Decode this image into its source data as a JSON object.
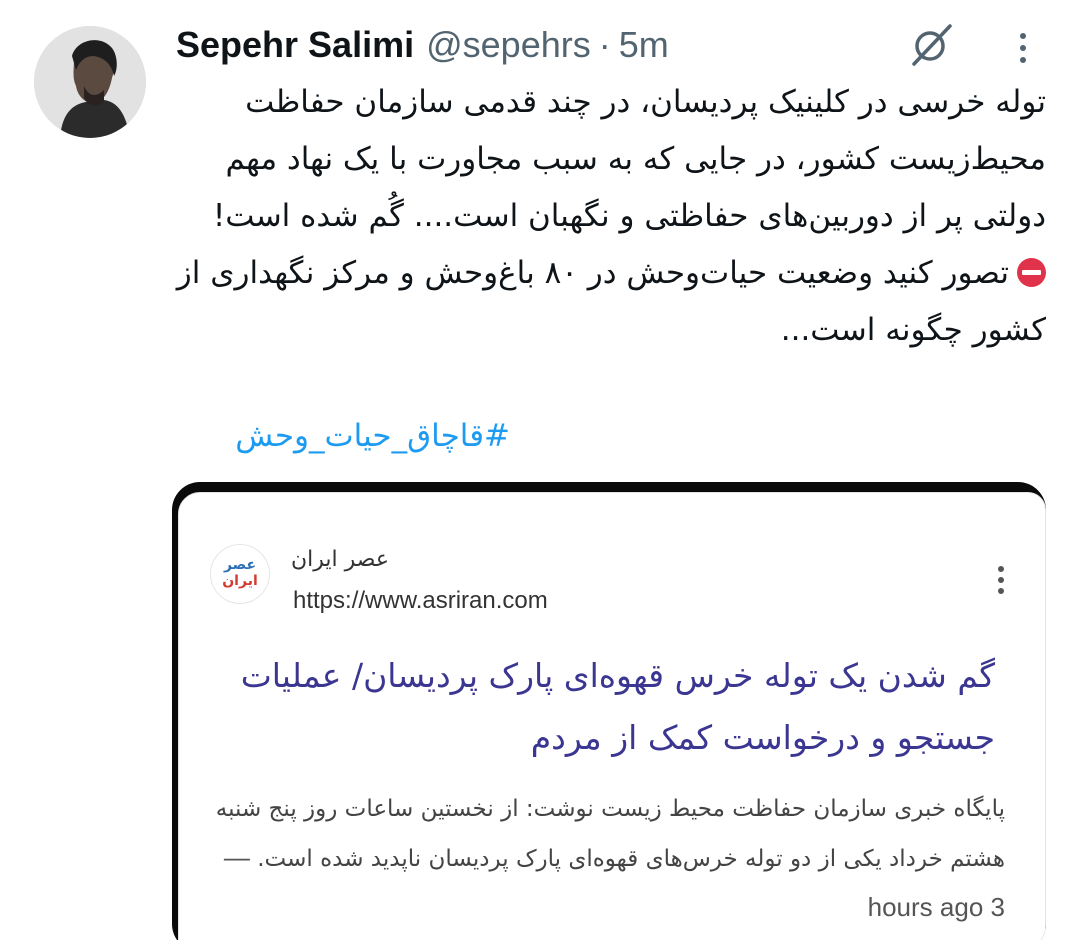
{
  "tweet": {
    "author_name": "Sepehr Salimi",
    "author_handle": "@sepehrs",
    "separator": "·",
    "time": "5m",
    "paragraph1": "توله خرسی در کلینیک پردیسان، در چند قدمی سازمان حفاظت محیط‌زیست کشور، در جایی که به سبب مجاورت با یک نهاد مهم دولتی پر از دوربین‌های حفاظتی و نگهبان است.... گُم شده است!",
    "paragraph2": "تصور کنید وضعیت حیات‌وحش در ۸۰ باغ‌وحش و مرکز نگهداری از کشور چگونه است...",
    "hashtag": "#قاچاق_حیات_وحش",
    "icons": {
      "grok": "grok-icon",
      "more": "more-vertical-icon",
      "no_entry": "no-entry-emoji"
    }
  },
  "card": {
    "logo_text_top": "عصر",
    "logo_text_bottom": "ایران",
    "source_name": "عصر ایران",
    "source_url": "https://www.asriran.com",
    "headline": "گم شدن یک توله خرس قهوه‌ای پارک پردیسان/ عملیات جستجو و درخواست کمک از مردم",
    "snippet_time": "3 hours ago",
    "snippet_dash": "—",
    "snippet_text": "پایگاه خبری سازمان حفاظت محیط زیست نوشت: از نخستین ساعات روز پنج شنبه هشتم خرداد یکی از دو توله خرس‌های قهوه‌ای پارک پردیسان ناپدید شده است."
  },
  "colors": {
    "hashtag": "#1d9bf0",
    "headline": "#3b3691",
    "muted": "#536471",
    "no_entry": "#e0334b"
  }
}
